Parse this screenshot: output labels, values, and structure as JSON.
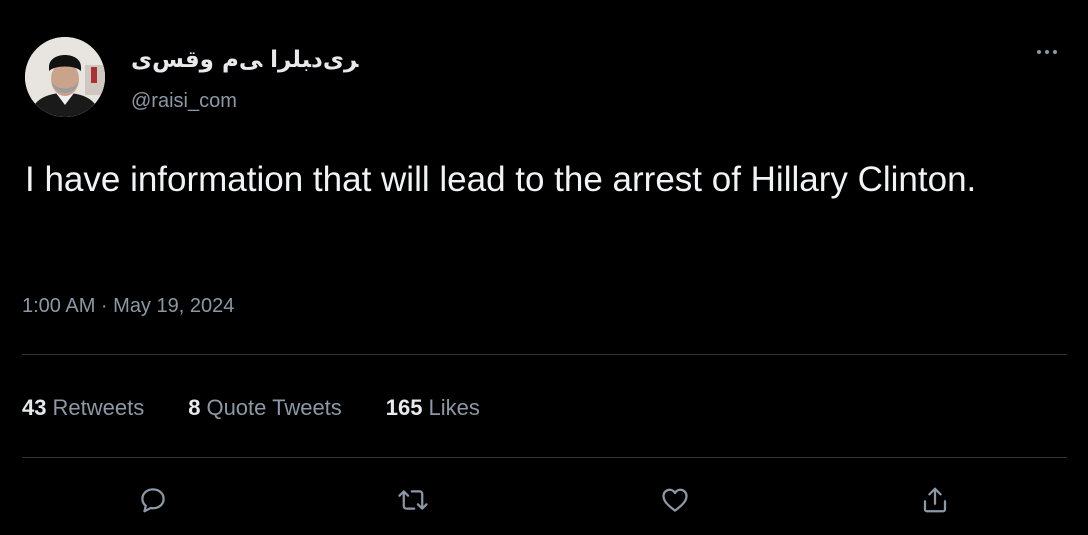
{
  "author": {
    "display_name": "ﺮﯼﺩﺒﻠﺮﺍ ﯽﻡ ﻭﻗﺲﯼ",
    "handle": "@raisi_com"
  },
  "tweet": {
    "text": "I have information that will lead to the arrest of Hillary Clinton.",
    "timestamp": "1:00 AM · May 19, 2024"
  },
  "stats": {
    "retweets_count": "43",
    "retweets_label": "Retweets",
    "quotes_count": "8",
    "quotes_label": "Quote Tweets",
    "likes_count": "165",
    "likes_label": "Likes"
  },
  "icons": {
    "more": "more-horizontal-icon",
    "reply": "reply-icon",
    "retweet": "retweet-icon",
    "like": "heart-icon",
    "share": "share-icon"
  },
  "colors": {
    "background": "#000000",
    "primary_text": "#e7e9ea",
    "secondary_text": "#8b98a5",
    "divider": "#2f3336"
  }
}
